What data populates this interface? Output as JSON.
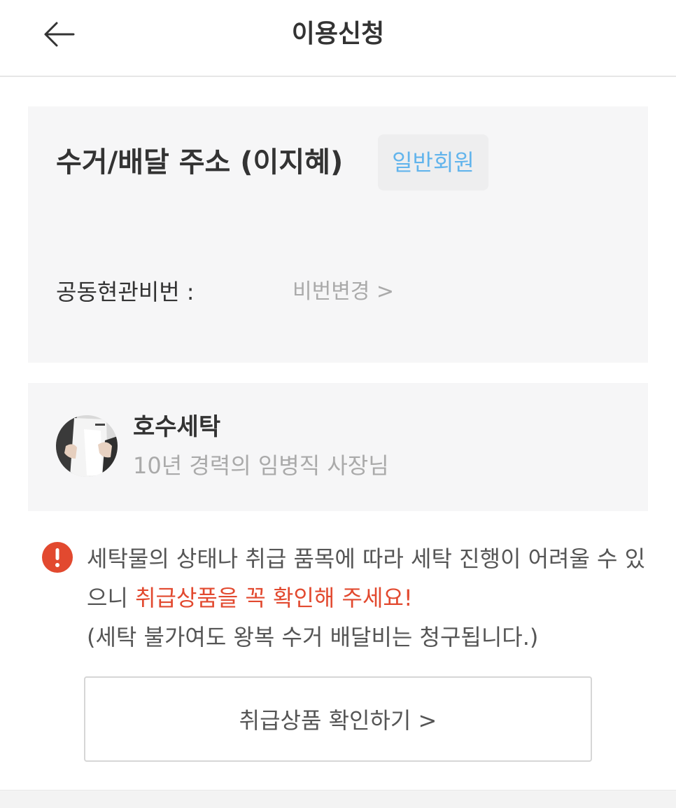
{
  "header": {
    "title": "이용신청",
    "back_icon": "arrow-left-icon"
  },
  "address": {
    "title": "수거/배달 주소 (이지혜)",
    "member_badge": "일반회원",
    "door_code_label": "공동현관비번 :",
    "door_code_change": "비번변경 >"
  },
  "shop": {
    "name": "호수세탁",
    "description": "10년 경력의 임병직 사장님"
  },
  "notice": {
    "icon": "exclamation-icon",
    "text_part1": "세탁물의 상태나 취급 품목에 따라 세탁 진행이 어려울 수 있으니 ",
    "text_warning": "취급상품을 꼭 확인해 주세요!",
    "text_part2": "(세탁 불가여도 왕복 수거 배달비는 청구됩니다.)"
  },
  "confirm_button": {
    "label": "취급상품 확인하기 >"
  },
  "colors": {
    "accent_blue": "#62b4ec",
    "warning_red": "#e2492f",
    "card_background": "#f6f6f7"
  }
}
